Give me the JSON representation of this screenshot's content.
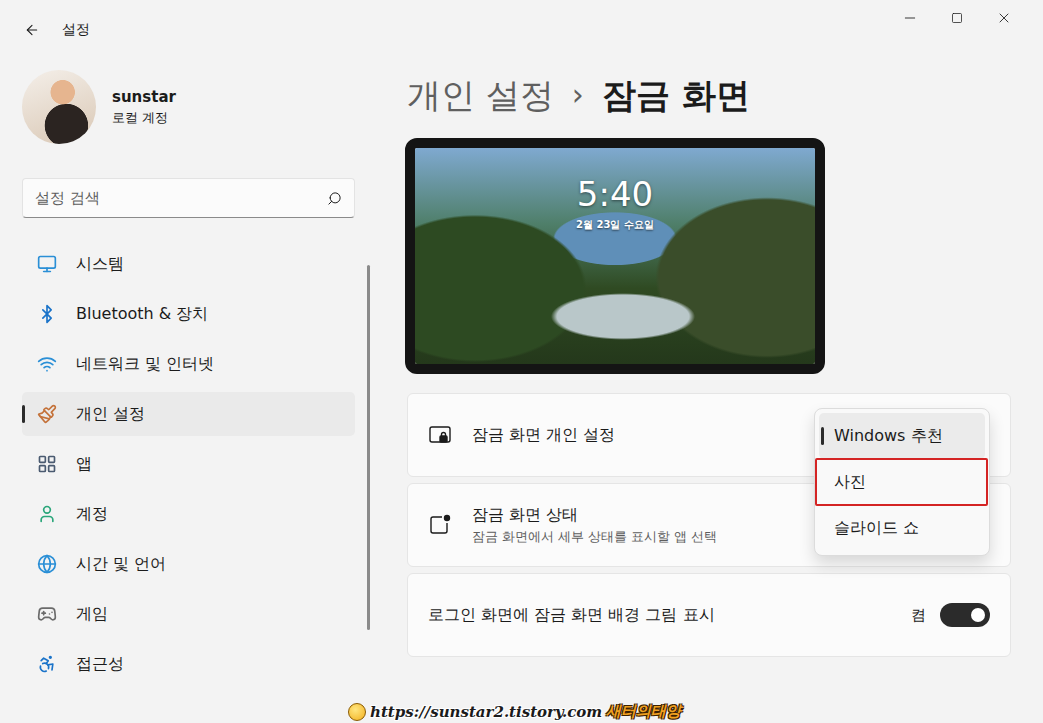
{
  "window": {
    "title": "설정"
  },
  "profile": {
    "name": "sunstar",
    "account": "로컬 계정"
  },
  "search": {
    "placeholder": "설정 검색"
  },
  "sidebar": {
    "items": [
      {
        "label": "시스템",
        "selected": false
      },
      {
        "label": "Bluetooth & 장치",
        "selected": false
      },
      {
        "label": "네트워크 및 인터넷",
        "selected": false
      },
      {
        "label": "개인 설정",
        "selected": true
      },
      {
        "label": "앱",
        "selected": false
      },
      {
        "label": "계정",
        "selected": false
      },
      {
        "label": "시간 및 언어",
        "selected": false
      },
      {
        "label": "게임",
        "selected": false
      },
      {
        "label": "접근성",
        "selected": false
      }
    ]
  },
  "breadcrumb": {
    "parent": "개인 설정",
    "separator": "›",
    "current": "잠금 화면"
  },
  "preview": {
    "time": "5:40",
    "date": "2월 23일 수요일"
  },
  "settings": [
    {
      "kind": "dropdown",
      "title": "잠금 화면 개인 설정",
      "expanded": true,
      "options": [
        {
          "label": "Windows 추천",
          "selected": true,
          "highlighted": false
        },
        {
          "label": "사진",
          "selected": false,
          "highlighted": true
        },
        {
          "label": "슬라이드 쇼",
          "selected": false,
          "highlighted": false
        }
      ]
    },
    {
      "kind": "link",
      "title": "잠금 화면 상태",
      "subtitle": "잠금 화면에서 세부 상태를 표시할 앱 선택"
    },
    {
      "kind": "toggle",
      "title": "로그인 화면에 잠금 화면 배경 그림 표시",
      "state_label": "켬",
      "on": true
    }
  ],
  "watermark": {
    "url": "https://sunstar2.tistory.com",
    "name": "새터의태양"
  }
}
